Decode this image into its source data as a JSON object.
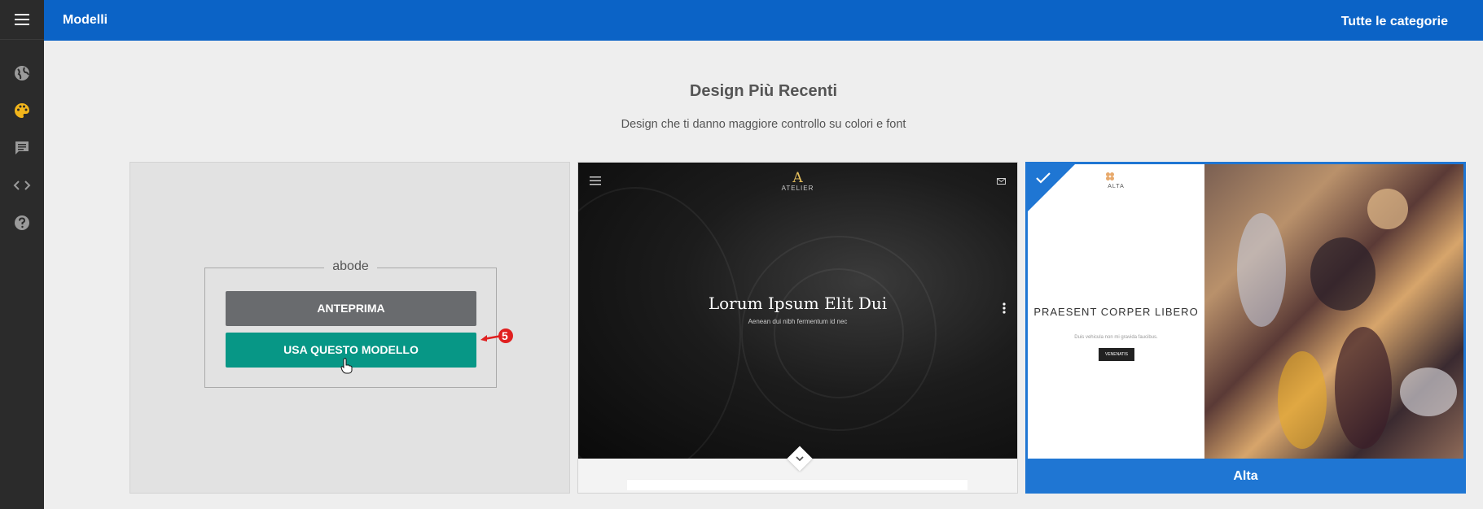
{
  "topbar": {
    "title": "Modelli",
    "categories_label": "Tutte le categorie"
  },
  "sidebar": {
    "icons": [
      "menu-icon",
      "globe-icon",
      "palette-icon",
      "comment-icon",
      "code-icon",
      "help-icon"
    ],
    "active_color": "#f2b51b"
  },
  "section": {
    "heading": "Design Più Recenti",
    "subheading": "Design che ti danno maggiore controllo su colori e font"
  },
  "cards": [
    {
      "name": "abode",
      "preview_label": "ANTEPRIMA",
      "use_label": "USA QUESTO MODELLO",
      "callout_number": "5"
    },
    {
      "brand_letter": "A",
      "brand_name": "ATELIER",
      "hero_title": "Lorum Ipsum Elit Dui",
      "hero_subtitle": "Aenean dui nibh fermentum id nec"
    },
    {
      "brand_name": "ALTA",
      "headline": "PRAESENT CORPER LIBERO",
      "subline": "Duis vehicula non mi gravida faucibus.",
      "button": "VENENATIS",
      "label": "Alta",
      "selected": true
    }
  ],
  "colors": {
    "topbar": "#0b63c6",
    "sidebar": "#2b2b2b",
    "use_button": "#079786",
    "preview_button": "#696b6e",
    "selected": "#1f76d3",
    "callout": "#e02020"
  }
}
